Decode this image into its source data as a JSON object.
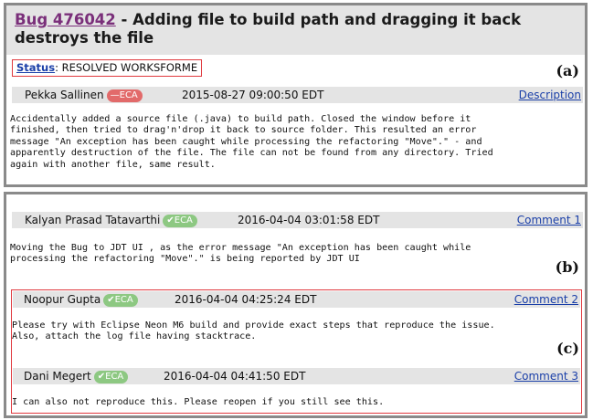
{
  "bug": {
    "id_label": "Bug 476042",
    "separator": " - ",
    "title_text": "Adding file to build path and dragging it back destroys the file",
    "status_label": "Status",
    "status_value": ": RESOLVED WORKSFORME"
  },
  "tags": {
    "a": "(a)",
    "b": "(b)",
    "c": "(c)"
  },
  "description": {
    "author": "Pekka Sallinen",
    "badge": "ECA",
    "badge_icon": "minus-circle-icon",
    "badge_color": "#e26a6a",
    "date": "2015-08-27 09:00:50 EDT",
    "link": "Description",
    "text": "Accidentally added a source file (.java) to build path. Closed the window before it\nfinished, then tried to drag'n'drop it back to source folder. This resulted an error\nmessage \"An exception has been caught while processing the refactoring \"Move\".\" - and\napparently destruction of the file. The file can not be found from any directory. Tried\nagain with another file, same result."
  },
  "comments": [
    {
      "author": "Kalyan Prasad Tatavarthi",
      "badge": "ECA",
      "badge_icon": "check-icon",
      "badge_color": "#8dc882",
      "date": "2016-04-04 03:01:58 EDT",
      "link": "Comment 1",
      "text": "Moving the Bug to JDT UI , as the error message \"An exception has been caught while\nprocessing the refactoring \"Move\".\" is being reported by JDT UI"
    },
    {
      "author": "Noopur Gupta",
      "badge": "ECA",
      "badge_icon": "check-icon",
      "badge_color": "#8dc882",
      "date": "2016-04-04 04:25:24 EDT",
      "link": "Comment 2",
      "text": "Please try with Eclipse Neon M6 build and provide exact steps that reproduce the issue.\nAlso, attach the log file having stacktrace."
    },
    {
      "author": "Dani Megert",
      "badge": "ECA",
      "badge_icon": "check-icon",
      "badge_color": "#8dc882",
      "date": "2016-04-04 04:41:50 EDT",
      "link": "Comment 3",
      "text": "I can also not reproduce this. Please reopen if you still see this."
    }
  ],
  "colors": {
    "link": "#1a3fa8",
    "visited_link": "#7a2f7a",
    "highlight_box": "#e0393e",
    "header_bg": "#e4e4e4",
    "panel_border": "#8a8a8a"
  }
}
